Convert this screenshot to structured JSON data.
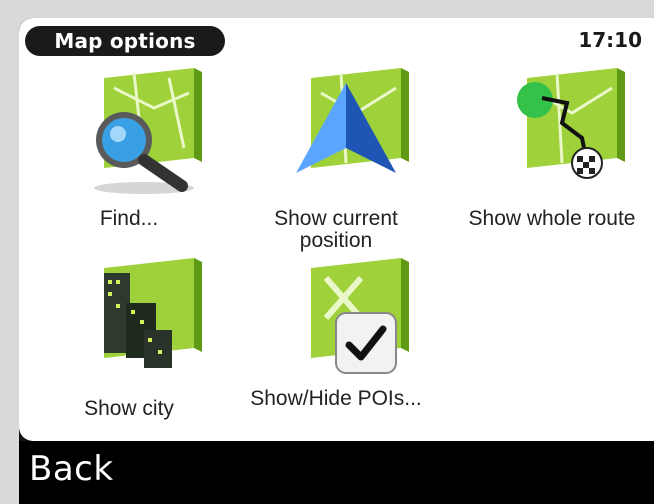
{
  "header": {
    "title": "Map options",
    "time": "17:10"
  },
  "tiles": [
    {
      "label": "Find...",
      "icon": "magnifier-map-icon"
    },
    {
      "label": "Show current position",
      "icon": "position-arrow-icon"
    },
    {
      "label": "Show whole route",
      "icon": "route-map-icon"
    },
    {
      "label": "Show city",
      "icon": "city-buildings-icon"
    },
    {
      "label": "Show/Hide POIs...",
      "icon": "poi-toggle-icon"
    }
  ],
  "footer": {
    "back_label": "Back"
  },
  "colors": {
    "map_green": "#9fd23a",
    "map_dark": "#5f9a14",
    "arrow_blue": "#2f6fd8",
    "bar": "#000000"
  }
}
